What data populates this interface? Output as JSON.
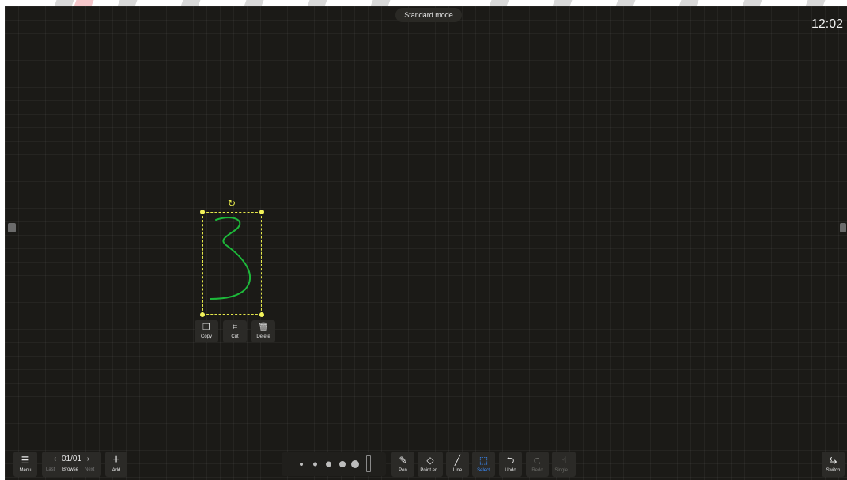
{
  "header": {
    "mode_label": "Standard mode",
    "clock": "12:02"
  },
  "canvas": {
    "background_color": "#1b1a17",
    "stroke_color": "#1db83a",
    "selection_color": "#e5e84a",
    "handwritten_glyph": "3"
  },
  "context_menu": {
    "copy": "Copy",
    "cut": "Cut",
    "delete": "Delete"
  },
  "toolbar": {
    "menu": "Menu",
    "page": "01/01",
    "last": "Last",
    "browse": "Browse",
    "next": "Next",
    "add": "Add",
    "pen": "Pen",
    "point_eraser": "Point er...",
    "line": "Line",
    "select": "Select",
    "undo": "Undo",
    "redo": "Redo",
    "single": "Single ...",
    "switch": "Switch",
    "active_tool": "Select",
    "active_color": "#3a8dff",
    "pen_sizes": 5
  },
  "icons": {
    "menu": "☰",
    "add": "+",
    "prev": "‹",
    "next": "›",
    "copy": "❐",
    "cut": "⌗",
    "delete": "🗑",
    "rotate": "↻",
    "pen": "✎",
    "eraser": "◇",
    "line": "╱",
    "select": "⬚",
    "undo": "⮌",
    "redo": "⮎",
    "hand": "☝",
    "switch": "⇆"
  }
}
